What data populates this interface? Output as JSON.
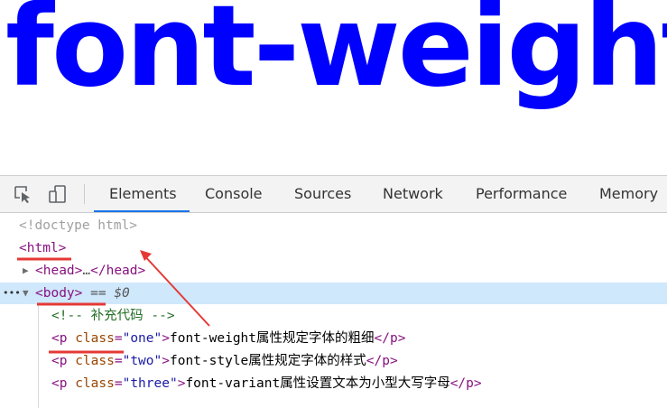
{
  "page": {
    "heading": "font-weight"
  },
  "devtools": {
    "tabs": [
      "Elements",
      "Console",
      "Sources",
      "Network",
      "Performance",
      "Memory"
    ],
    "active_tab": "Elements",
    "tree": {
      "doctype": "<!doctype html>",
      "html_open": "<html>",
      "head": {
        "open": "<head>",
        "ellipsis": "…",
        "close": "</head>"
      },
      "body": {
        "dots": "•••",
        "open": "<body>",
        "selected_marker": "== $0"
      },
      "comment": "<!-- 补充代码 -->",
      "paragraphs": [
        {
          "tag_open": "<p",
          "attr": "class",
          "eq": "=",
          "value": "\"one\"",
          "close_bracket": ">",
          "text": "font-weight属性规定字体的粗细",
          "tag_close": "</p>"
        },
        {
          "tag_open": "<p",
          "attr": "class",
          "eq": "=",
          "value": "\"two\"",
          "close_bracket": ">",
          "text": "font-style属性规定字体的样式",
          "tag_close": "</p>"
        },
        {
          "tag_open": "<p",
          "attr": "class",
          "eq": "=",
          "value": "\"three\"",
          "close_bracket": ">",
          "text": "font-variant属性设置文本为小型大写字母",
          "tag_close": "</p>"
        }
      ]
    }
  },
  "colors": {
    "heading": "#0000ff",
    "annotation": "#e53935",
    "selection": "#cfe8fc",
    "active_tab_indicator": "#1a73e8"
  }
}
